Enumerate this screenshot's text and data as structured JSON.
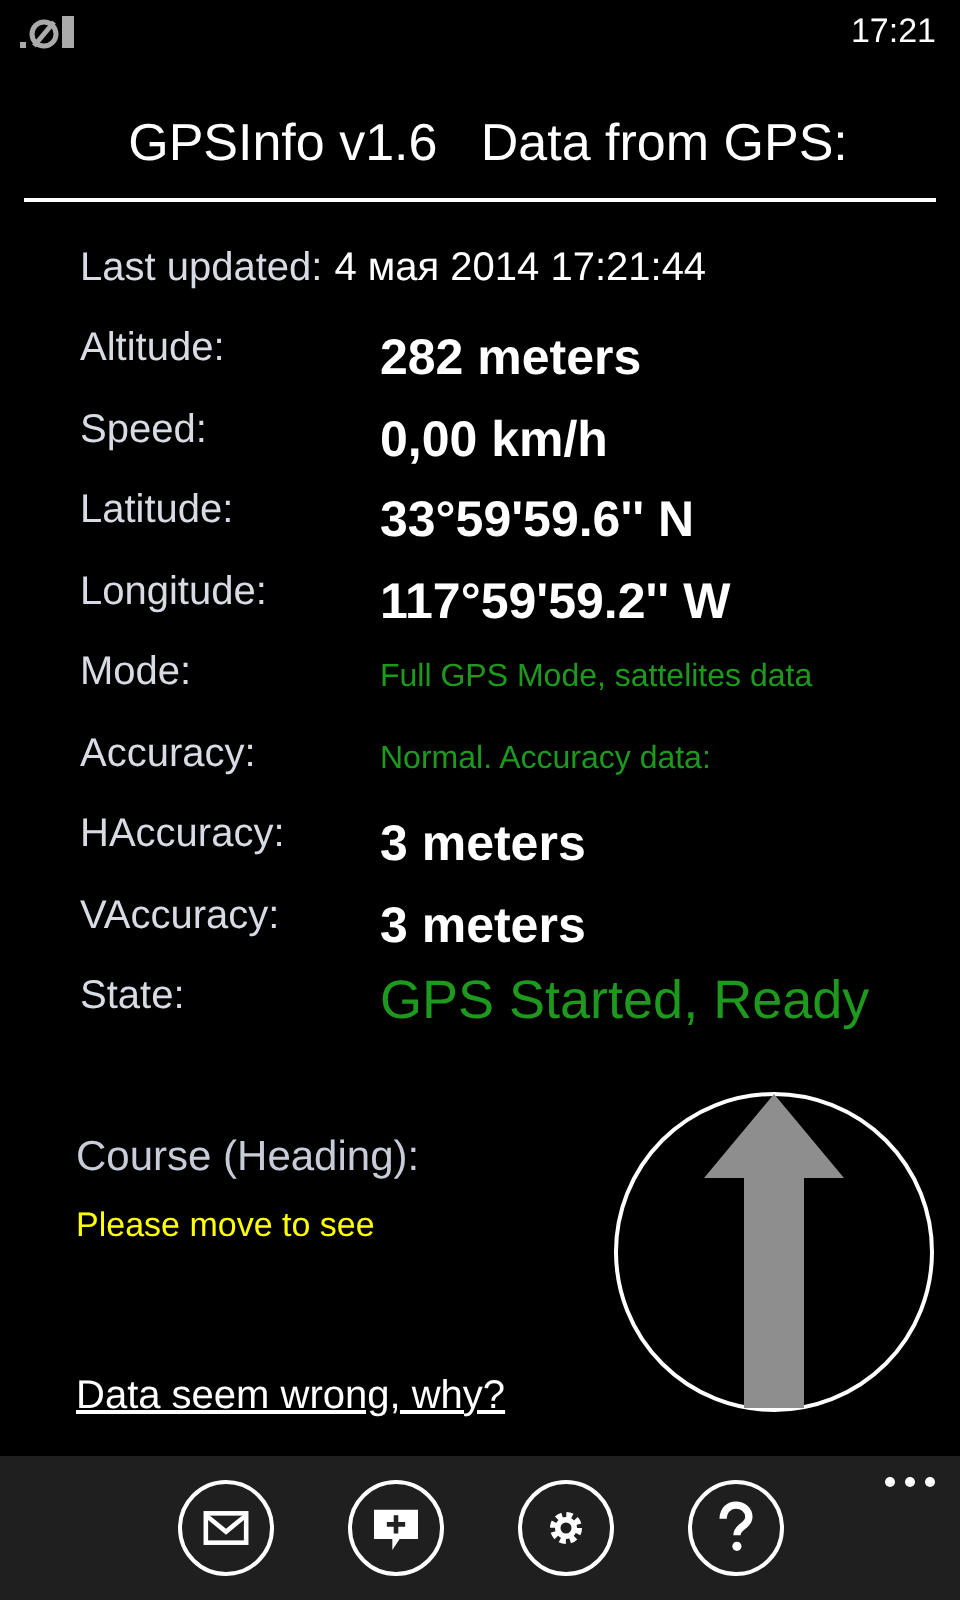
{
  "status_bar": {
    "time": "17:21"
  },
  "header": {
    "title": "GPSInfo v1.6   Data from GPS:"
  },
  "rows": [
    {
      "label": "Last updated:",
      "value": "4 мая 2014 17:21:44",
      "kind": "date"
    },
    {
      "label": "Altitude:",
      "value": "282 meters",
      "kind": "bold"
    },
    {
      "label": "Speed:",
      "value": "0,00 km/h",
      "kind": "bold"
    },
    {
      "label": "Latitude:",
      "value": "33°59'59.6'' N",
      "kind": "bold"
    },
    {
      "label": "Longitude:",
      "value": "117°59'59.2'' W",
      "kind": "bold"
    },
    {
      "label": "Mode:",
      "value": "Full GPS Mode, sattelites data",
      "kind": "note"
    },
    {
      "label": "Accuracy:",
      "value": "Normal. Accuracy data:",
      "kind": "note"
    },
    {
      "label": "HAccuracy:",
      "value": "3 meters",
      "kind": "bold"
    },
    {
      "label": "VAccuracy:",
      "value": "3 meters",
      "kind": "bold"
    },
    {
      "label": "State:",
      "value": "GPS Started, Ready",
      "kind": "status"
    }
  ],
  "course": {
    "label": "Course (Heading):",
    "hint": "Please move to see"
  },
  "help_link": "Data seem wrong, why?",
  "app_bar": {
    "buttons": [
      {
        "kind": "mail"
      },
      {
        "kind": "comment"
      },
      {
        "kind": "settings"
      },
      {
        "kind": "help"
      }
    ]
  }
}
